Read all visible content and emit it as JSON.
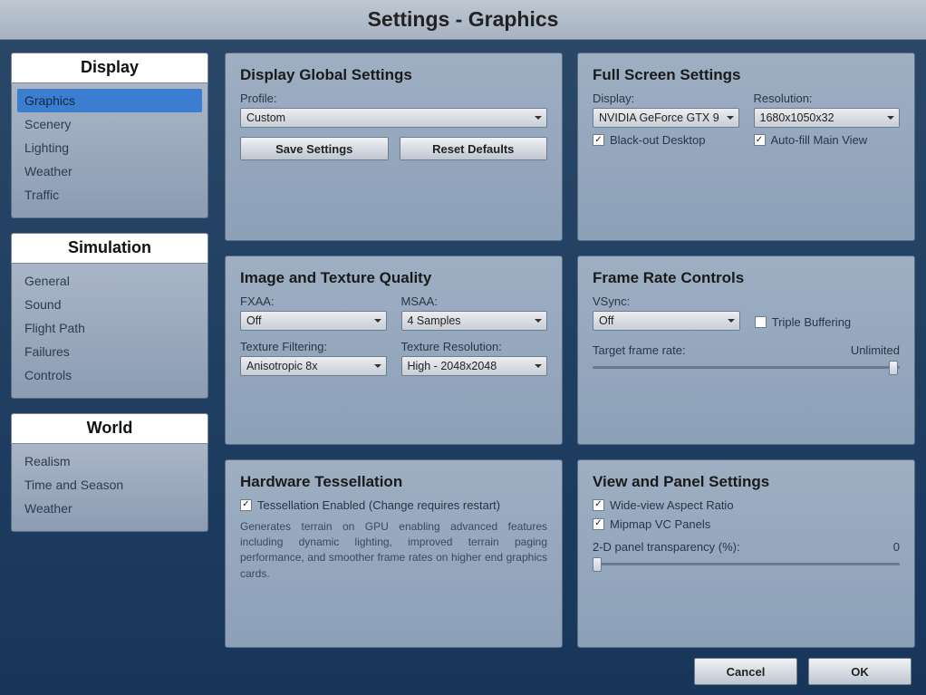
{
  "title": "Settings - Graphics",
  "sidebar": [
    {
      "header": "Display",
      "items": [
        {
          "label": "Graphics",
          "selected": true
        },
        {
          "label": "Scenery"
        },
        {
          "label": "Lighting"
        },
        {
          "label": "Weather"
        },
        {
          "label": "Traffic"
        }
      ]
    },
    {
      "header": "Simulation",
      "items": [
        {
          "label": "General"
        },
        {
          "label": "Sound"
        },
        {
          "label": "Flight Path"
        },
        {
          "label": "Failures"
        },
        {
          "label": "Controls"
        }
      ]
    },
    {
      "header": "World",
      "items": [
        {
          "label": "Realism"
        },
        {
          "label": "Time and Season"
        },
        {
          "label": "Weather"
        }
      ]
    }
  ],
  "panels": {
    "global": {
      "title": "Display Global Settings",
      "profile_label": "Profile:",
      "profile_value": "Custom",
      "save_btn": "Save Settings",
      "reset_btn": "Reset Defaults"
    },
    "fullscreen": {
      "title": "Full Screen Settings",
      "display_label": "Display:",
      "display_value": "NVIDIA GeForce GTX 9",
      "resolution_label": "Resolution:",
      "resolution_value": "1680x1050x32",
      "blackout": {
        "label": "Black-out Desktop",
        "checked": true
      },
      "autofill": {
        "label": "Auto-fill Main View",
        "checked": true
      }
    },
    "imagequality": {
      "title": "Image and Texture Quality",
      "fxaa_label": "FXAA:",
      "fxaa_value": "Off",
      "msaa_label": "MSAA:",
      "msaa_value": "4 Samples",
      "texfilter_label": "Texture Filtering:",
      "texfilter_value": "Anisotropic 8x",
      "texres_label": "Texture Resolution:",
      "texres_value": "High - 2048x2048"
    },
    "framerate": {
      "title": "Frame Rate Controls",
      "vsync_label": "VSync:",
      "vsync_value": "Off",
      "triple_buffer": {
        "label": "Triple Buffering",
        "checked": false
      },
      "target_label": "Target frame rate:",
      "target_value": "Unlimited",
      "slider_pos_pct": 98
    },
    "tessellation": {
      "title": "Hardware Tessellation",
      "enabled": {
        "label": "Tessellation Enabled (Change requires restart)",
        "checked": true
      },
      "desc": "Generates terrain on GPU enabling advanced features including dynamic lighting, improved terrain paging performance, and smoother frame rates on higher end graphics cards."
    },
    "viewpanel": {
      "title": "View and Panel Settings",
      "wideview": {
        "label": "Wide-view Aspect Ratio",
        "checked": true
      },
      "mipmap": {
        "label": "Mipmap VC Panels",
        "checked": true
      },
      "panel_transparency_label": "2-D panel transparency (%):",
      "panel_transparency_value": "0",
      "slider_pos_pct": 0
    }
  },
  "footer": {
    "cancel": "Cancel",
    "ok": "OK"
  }
}
